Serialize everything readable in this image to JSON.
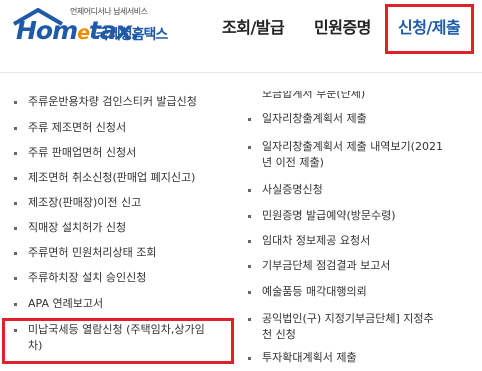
{
  "logo": {
    "tagline": "언제어디서나 납세서비스",
    "brand": "Hometax",
    "name_kr": "국세청홈택스"
  },
  "nav": {
    "items": [
      "조회/발급",
      "민원증명",
      "신청/제출"
    ]
  },
  "left_items": [
    "주류운반용차량 검인스티커 발급신청",
    "주류 제조면허 신청서",
    "주류 판매업면허 신청서",
    "제조면허 취소신청(판매업 폐지신고)",
    "제조장(판매장)이전 신고",
    "직매장 설치허가 신청",
    "주류면허 민원처리상태 조회",
    "주류하치장 설치 승인신청",
    "APA 연례보고서",
    "미납국세등 열람신청 (주택임차,상가임",
    "차)"
  ],
  "right_items": [
    "모금합계서 부문(단체)",
    "일자리창출계획서 제출",
    "일자리창출계획서 제출 내역보기(2021",
    "년 이전 제출)",
    "사실증명신청",
    "민원증명 발급예약(방문수령)",
    "임대차 정보제공 요청서",
    "기부금단체 점검결과 보고서",
    "예술품등 매각대행의뢰",
    "공익법인(구) 지정기부금단체] 지정추",
    "천 신청",
    "투자확대계획서 제출"
  ],
  "colors": {
    "accent": "#1e5aa8",
    "highlight": "#e0202a",
    "logo_orange": "#f08c00"
  }
}
